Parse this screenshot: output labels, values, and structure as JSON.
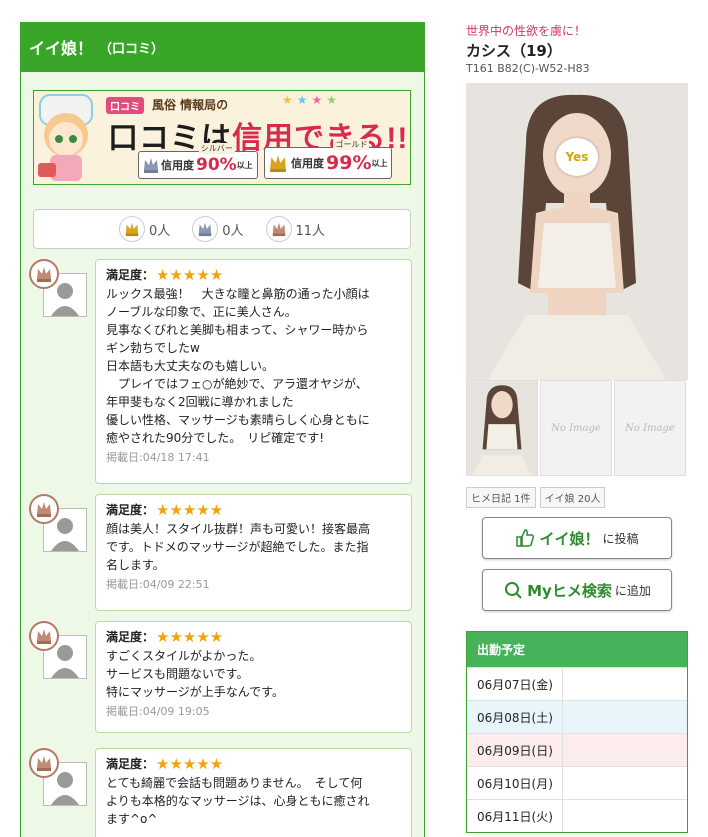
{
  "section": {
    "title": "イイ娘！",
    "subtitle": "（口コミ）"
  },
  "banner": {
    "logo_chip": "口コミ",
    "logo_text": "風俗 情報局の",
    "headline_a": "口コミは",
    "headline_b": "信用できる!!",
    "silver": {
      "tag": "シルバー",
      "label": "信用度",
      "pct": "90%",
      "suffix": "以上"
    },
    "gold": {
      "tag": "ゴールド",
      "label": "信用度",
      "pct": "99%",
      "suffix": "以上"
    }
  },
  "counts": [
    {
      "icon": "gold-crown-icon",
      "color": "#d9a520",
      "value": "0人"
    },
    {
      "icon": "silver-crown-icon",
      "color": "#8a97b0",
      "value": "0人"
    },
    {
      "icon": "bronze-crown-icon",
      "color": "#c08a74",
      "value": "11人"
    }
  ],
  "reviews": [
    {
      "label": "満足度：",
      "stars": "★★★★★",
      "text": "ルックス最強！　大きな瞳と鼻筋の通った小顔は\nノーブルな印象で、正に美人さん。\n見事なくびれと美脚も相まって、シャワー時から\nギン勃ちでしたw\n日本語も大丈夫なのも嬉しい。\n　プレイではフェ○が絶妙で、アラ還オヤジが、\n年甲斐もなく2回戦に導かれました\n優しい性格、マッサージも素晴らしく心身ともに\n癒やされた90分でした。　リピ確定です!",
      "date": "掲載日:04/18 17:41"
    },
    {
      "label": "満足度：",
      "stars": "★★★★★",
      "text": "顔は美人！スタイル抜群！声も可愛い！接客最高\nです。トドメのマッサージが超絶でした。また指\n名します。",
      "date": "掲載日:04/09 22:51"
    },
    {
      "label": "満足度：",
      "stars": "★★★★★",
      "text": "すごくスタイルがよかった。\nサービスも問題ないです。\n特にマッサージが上手なんです。",
      "date": "掲載日:04/09 19:05"
    },
    {
      "label": "満足度：",
      "stars": "★★★★★",
      "text": "とても綺麗で会話も問題ありません。　そして何\nよりも本格的なマッサージは、心身ともに癒され\nます^o^",
      "date": ""
    }
  ],
  "profile": {
    "catch": "世界中の性欲を虜に！",
    "name": "カシス（19）",
    "specs": "T161 B82(C)-W52-H83",
    "photo_stamp": "Yes"
  },
  "thumbs": [
    "",
    "No Image",
    "No Image"
  ],
  "pills": [
    "ヒメ日記 1件",
    "イイ娘 20人"
  ],
  "buttons": {
    "like_big": "イイ娘！",
    "like_small": "に投稿",
    "search_big": "Myヒメ検索",
    "search_small": "に追加"
  },
  "schedule": {
    "title": "出勤予定",
    "rows": [
      {
        "date": "06月07日(金)",
        "bg": "#ffffff"
      },
      {
        "date": "06月08日(土)",
        "bg": "#e8f6fb"
      },
      {
        "date": "06月09日(日)",
        "bg": "#fcecec"
      },
      {
        "date": "06月10日(月)",
        "bg": "#ffffff"
      },
      {
        "date": "06月11日(火)",
        "bg": "#ffffff"
      }
    ]
  }
}
